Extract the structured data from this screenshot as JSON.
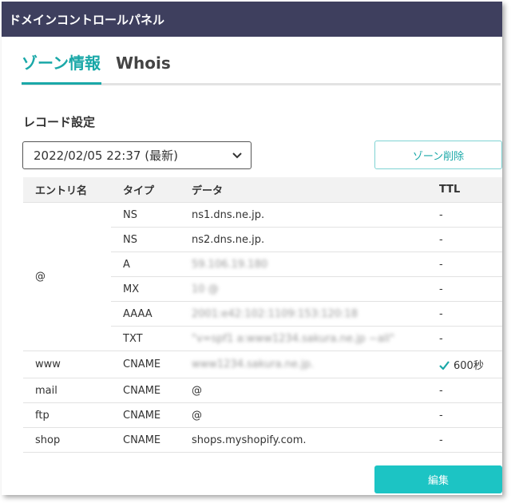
{
  "window": {
    "title": "ドメインコントロールパネル"
  },
  "tabs": [
    {
      "label": "ゾーン情報",
      "active": true
    },
    {
      "label": "Whois",
      "active": false
    }
  ],
  "records": {
    "title": "レコード設定",
    "version_select": {
      "value": "2022/02/05 22:37 (最新)"
    },
    "delete_zone_label": "ゾーン削除",
    "columns": [
      "エントリ名",
      "タイプ",
      "データ",
      "TTL"
    ],
    "rows": [
      {
        "entry": "@",
        "type": "NS",
        "data": "ns1.dns.ne.jp.",
        "ttl": "-"
      },
      {
        "entry": "",
        "type": "NS",
        "data": "ns2.dns.ne.jp.",
        "ttl": "-"
      },
      {
        "entry": "",
        "type": "A",
        "data": "59.106.19.180",
        "ttl": "-"
      },
      {
        "entry": "",
        "type": "MX",
        "data": "10 @",
        "ttl": "-"
      },
      {
        "entry": "",
        "type": "AAAA",
        "data": "2001:e42:102:1109:153:120:18",
        "ttl": "-"
      },
      {
        "entry": "",
        "type": "TXT",
        "data": "\"v=spf1 a:www1234.sakura.ne.jp ~all\"",
        "ttl": "-"
      },
      {
        "entry": "www",
        "type": "CNAME",
        "data": "www1234.sakura.ne.jp.",
        "ttl": "600秒"
      },
      {
        "entry": "mail",
        "type": "CNAME",
        "data": "@",
        "ttl": "-"
      },
      {
        "entry": "ftp",
        "type": "CNAME",
        "data": "@",
        "ttl": "-"
      },
      {
        "entry": "shop",
        "type": "CNAME",
        "data": "shops.myshopify.com.",
        "ttl": "-"
      }
    ]
  },
  "edit_button_label": "編集",
  "colors": {
    "accent": "#1aa8a8",
    "primary_button": "#1cc4c4",
    "titlebar": "#3e3f5e"
  }
}
